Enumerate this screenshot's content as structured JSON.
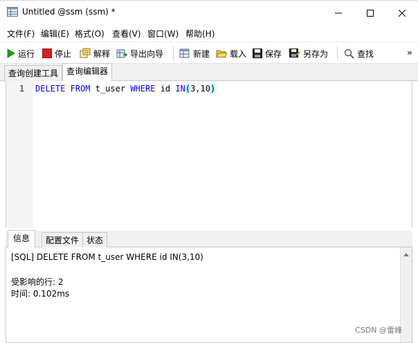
{
  "window": {
    "title": "Untitled @ssm (ssm) *"
  },
  "menu": {
    "items": [
      "文件(F)",
      "编辑(E)",
      "格式(O)",
      "查看(V)",
      "窗口(W)",
      "帮助(H)"
    ]
  },
  "toolbar": {
    "run": "运行",
    "stop": "停止",
    "explain": "解释",
    "export_wizard": "导出向导",
    "new": "新建",
    "load": "载入",
    "save": "保存",
    "save_as": "另存为",
    "find": "查找",
    "more": "»"
  },
  "tabs_top": [
    "查询创建工具",
    "查询编辑器"
  ],
  "editor": {
    "line_number": "1",
    "kw_delete": "DELETE",
    "kw_from": "FROM",
    "table": "t_user",
    "kw_where": "WHERE",
    "column": "id",
    "kw_in": "IN",
    "open_paren": "(",
    "values": "3,10",
    "close_paren": ")"
  },
  "tabs_bottom": [
    "信息",
    "配置文件",
    "状态"
  ],
  "output": {
    "sql_line": "[SQL] DELETE FROM t_user WHERE id IN(3,10)",
    "affected_rows": "受影响的行: 2",
    "time": "时间: 0.102ms"
  },
  "watermark": "CSDN @雷峰",
  "colors": {
    "keyword": "#0000ff",
    "bracket_highlight": "#b9f7f7",
    "run_icon": "#1aa31a",
    "stop_icon": "#d81e1e"
  }
}
